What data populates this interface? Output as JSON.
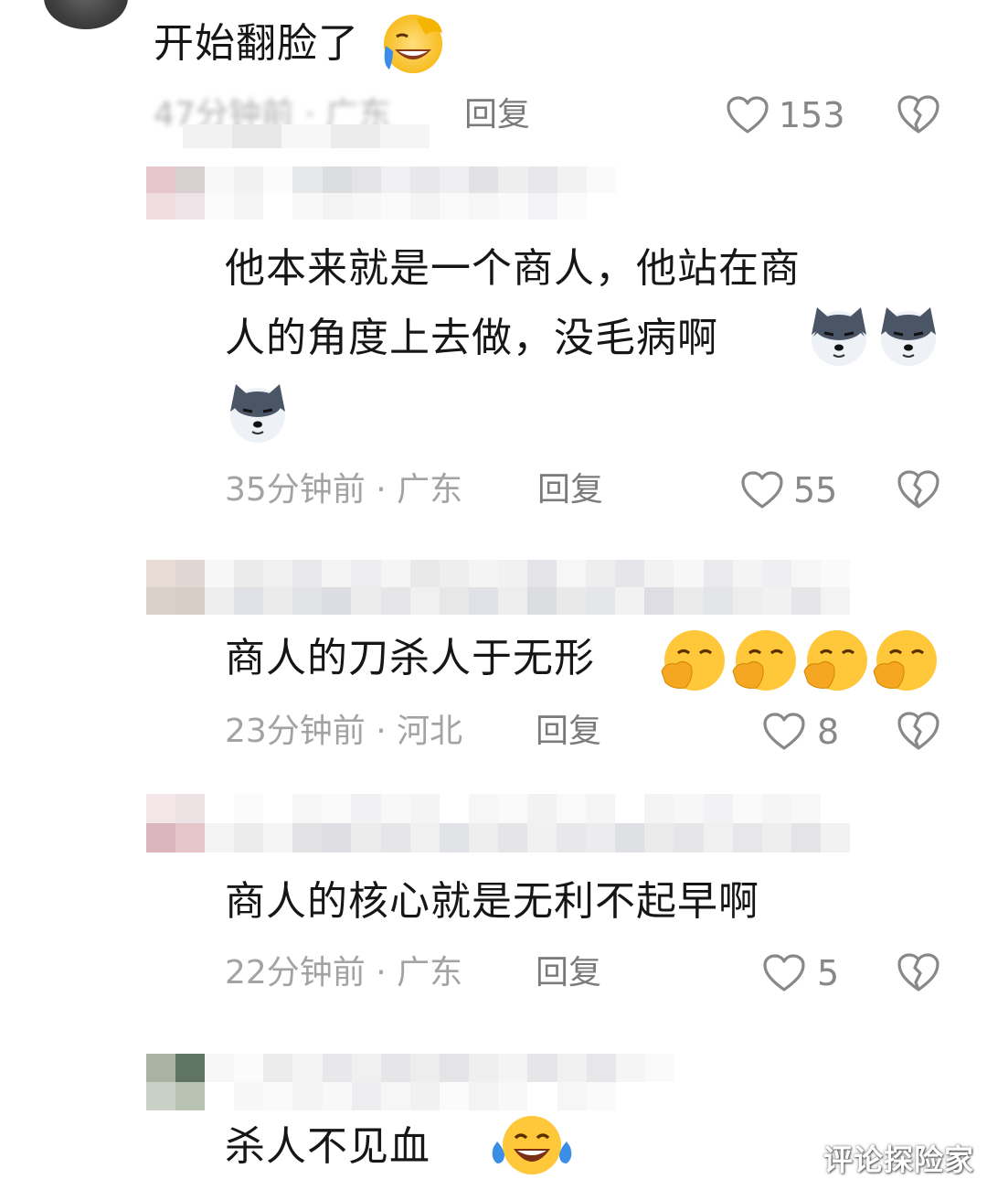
{
  "comments": [
    {
      "text": "开始翻脸了",
      "emojis": [
        "facepalm-laugh-emoji"
      ],
      "meta": "47分钟前 · 广东",
      "reply": "回复",
      "likes": "153"
    },
    {
      "text_line1": "他本来就是一个商人，他站在商",
      "text_line2": "人的角度上去做，没毛病啊",
      "emojis": [
        "husky-smirk-emoji",
        "husky-smirk-emoji",
        "husky-smirk-emoji"
      ],
      "meta": "35分钟前 · 广东",
      "reply": "回复",
      "likes": "55"
    },
    {
      "text": "商人的刀杀人于无形",
      "emojis": [
        "cover-mouth-smile-emoji",
        "cover-mouth-smile-emoji",
        "cover-mouth-smile-emoji",
        "cover-mouth-smile-emoji"
      ],
      "meta": "23分钟前 · 河北",
      "reply": "回复",
      "likes": "8"
    },
    {
      "text": "商人的核心就是无利不起早啊",
      "meta": "22分钟前 · 广东",
      "reply": "回复",
      "likes": "5"
    },
    {
      "text": "杀人不见血",
      "emojis": [
        "tears-of-joy-emoji"
      ]
    }
  ],
  "watermark": "评论探险家",
  "colors": {
    "meta": "#a3a3a3",
    "reply": "#7b7b7b",
    "text": "#161616"
  }
}
